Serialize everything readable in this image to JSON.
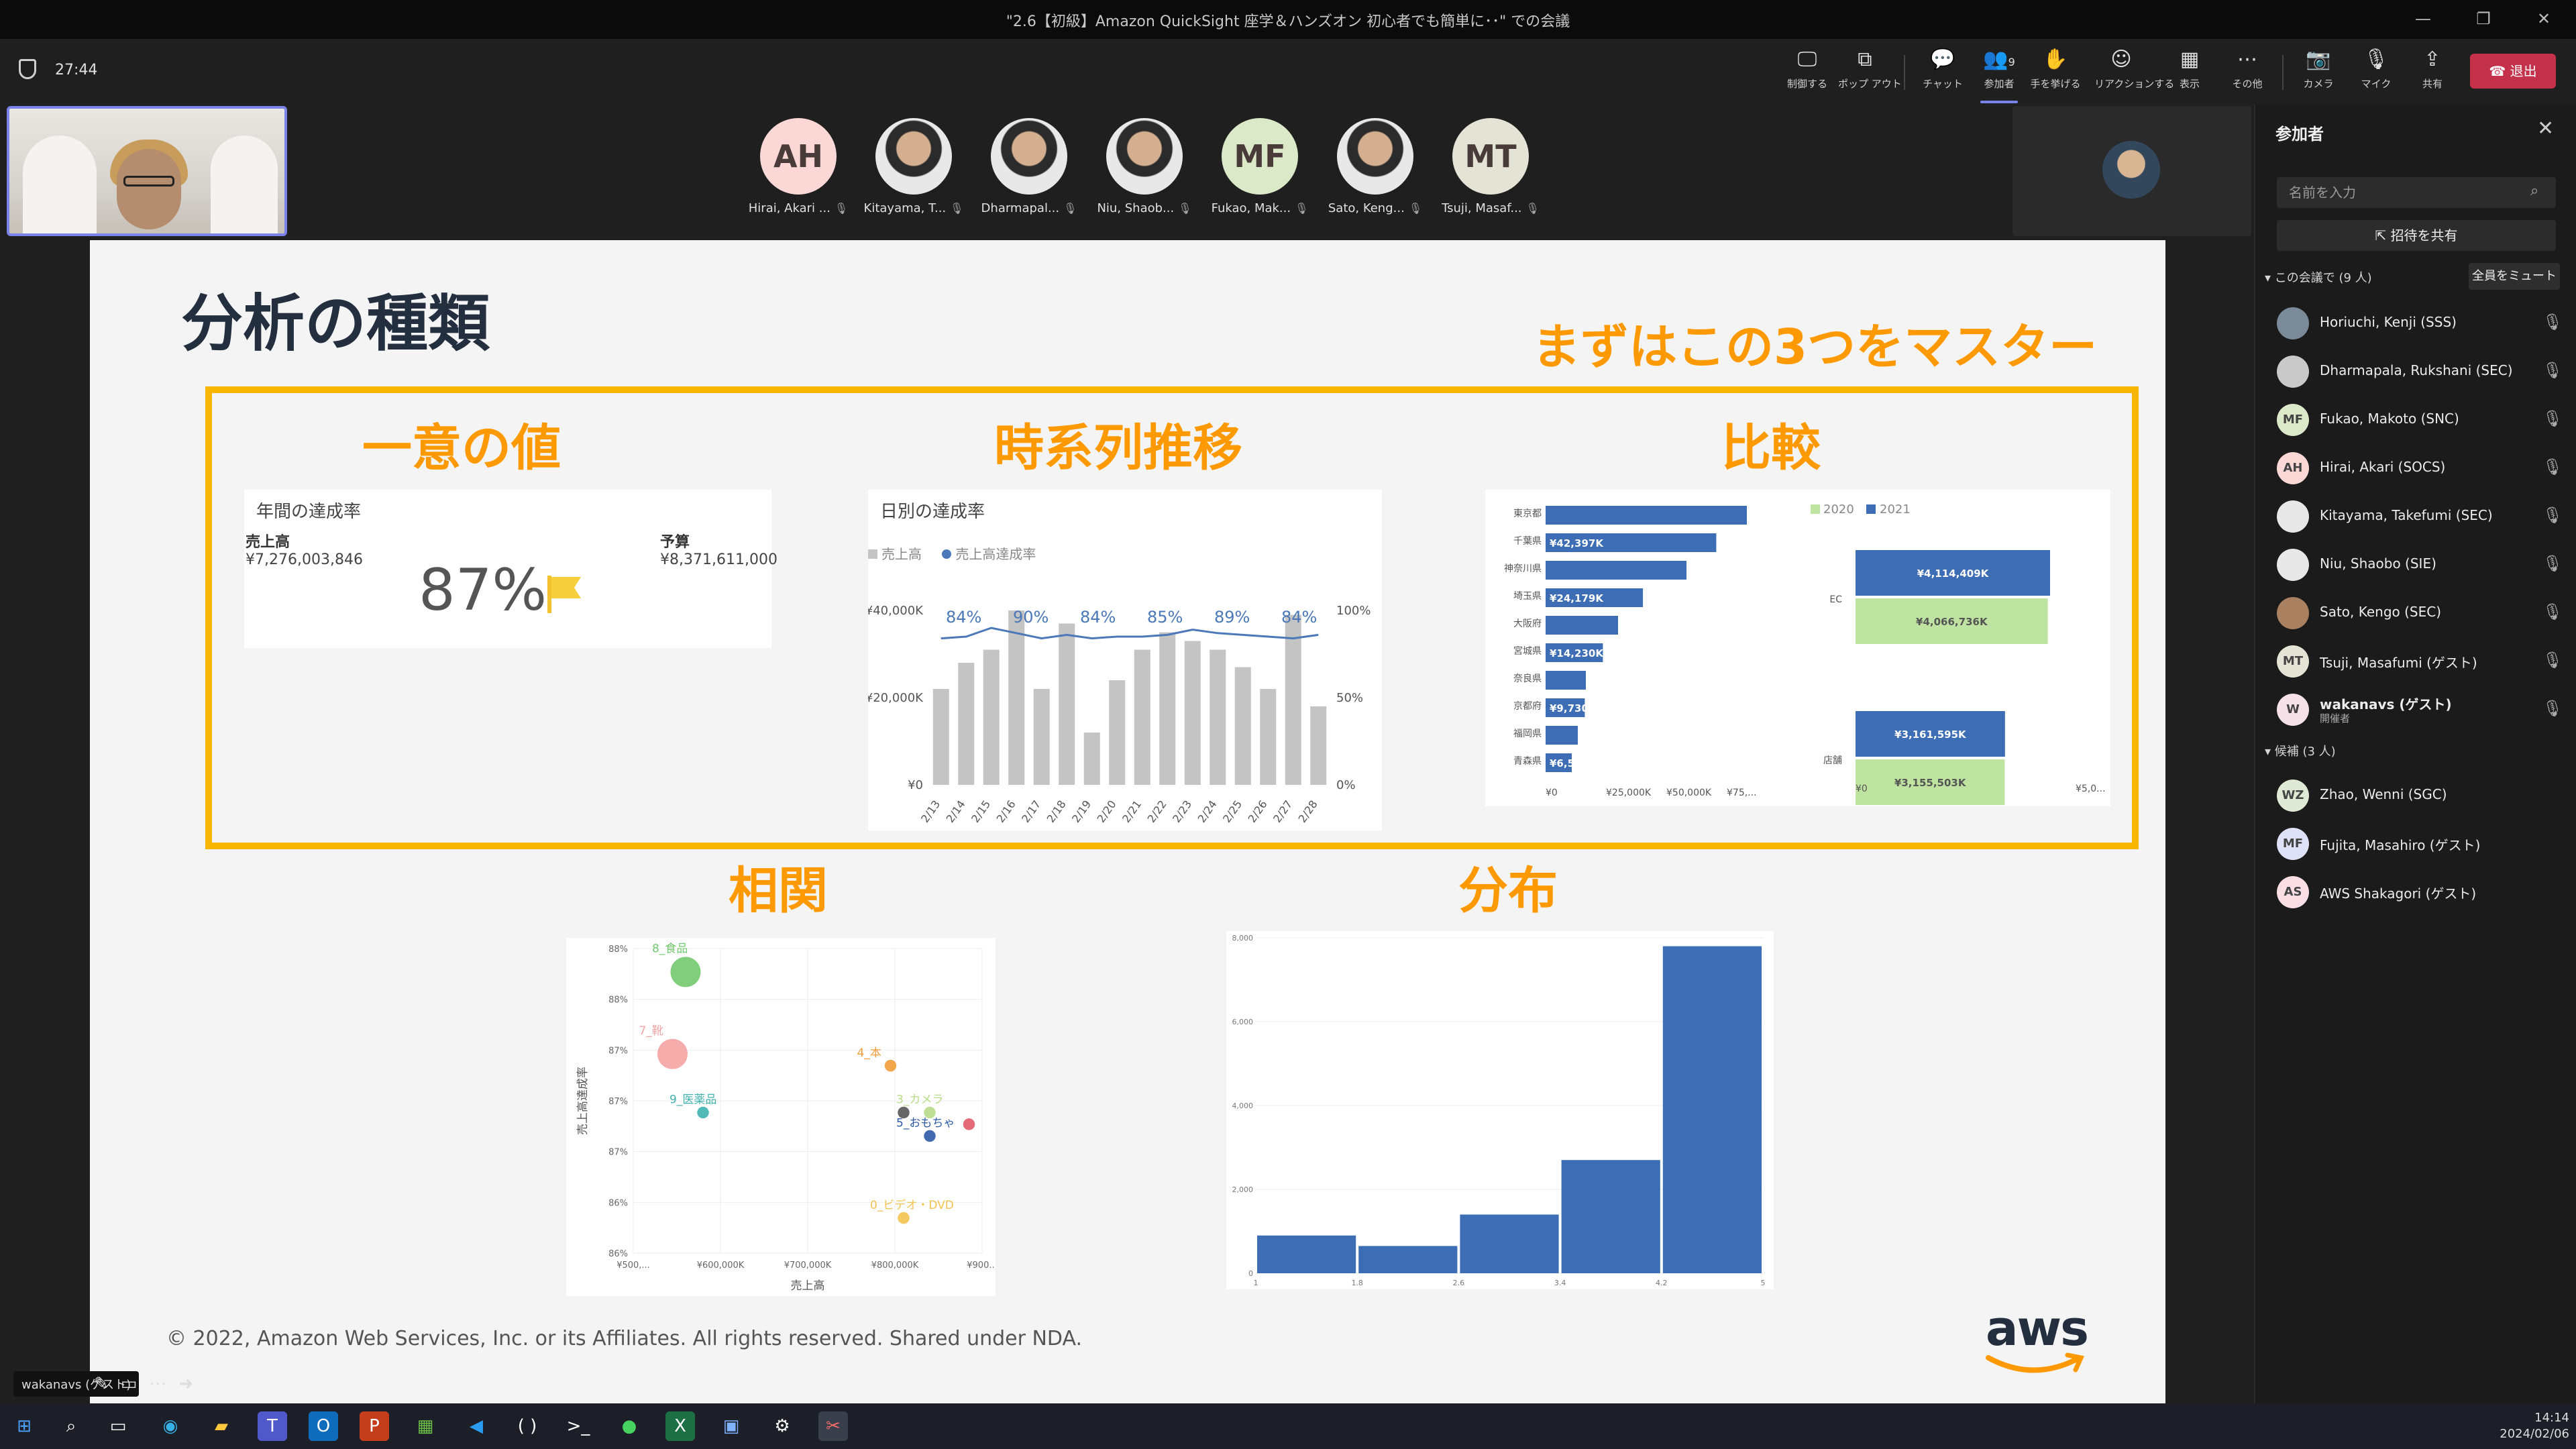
{
  "window": {
    "title": "\"2.6【初級】Amazon QuickSight 座学＆ハンズオン 初心者でも簡単に･･\" での会議",
    "controls": [
      "—",
      "❐",
      "✕"
    ]
  },
  "meeting": {
    "timer": "27:44",
    "toolbar": [
      {
        "name": "control",
        "label": "制御する",
        "icon": "🖵"
      },
      {
        "name": "popout",
        "label": "ポップ アウト",
        "icon": "⧉"
      },
      {
        "name": "chat",
        "label": "チャット",
        "icon": "💬"
      },
      {
        "name": "participants",
        "label": "参加者",
        "icon": "👥",
        "badge": "9"
      },
      {
        "name": "raise-hand",
        "label": "手を挙げる",
        "icon": "✋"
      },
      {
        "name": "react",
        "label": "リアクションする",
        "icon": "☺"
      },
      {
        "name": "view",
        "label": "表示",
        "icon": "▦"
      },
      {
        "name": "more",
        "label": "その他",
        "icon": "⋯"
      },
      {
        "name": "camera",
        "label": "カメラ",
        "icon": "📷"
      },
      {
        "name": "mic",
        "label": "マイク",
        "icon": "🎙"
      },
      {
        "name": "share",
        "label": "共有",
        "icon": "⇪"
      }
    ],
    "leave_label": "退出",
    "stage_participants": [
      {
        "initials": "AH",
        "name": "Hirai, Akari ...",
        "color": "#fbd8d6"
      },
      {
        "initials": "",
        "name": "Kitayama, T...",
        "color": "#d9d9d9"
      },
      {
        "initials": "",
        "name": "Dharmapal...",
        "color": "#d9d9d9"
      },
      {
        "initials": "",
        "name": "Niu, Shaob...",
        "color": "#d9d9d9"
      },
      {
        "initials": "MF",
        "name": "Fukao, Mak...",
        "color": "#dbe9c9"
      },
      {
        "initials": "",
        "name": "Sato, Keng...",
        "color": "#d9d9d9"
      },
      {
        "initials": "MT",
        "name": "Tsuji, Masaf...",
        "color": "#e3e3d6"
      }
    ],
    "self_name_chip": "wakanavs (ゲスト)"
  },
  "slide": {
    "title": "分析の種類",
    "subtitle": "まずはこの3つをマスター",
    "sections": {
      "unique": "一意の値",
      "timeseries": "時系列推移",
      "compare": "比較",
      "correlation": "相関",
      "distribution": "分布"
    },
    "kpi": {
      "title": "年間の達成率",
      "sales_label": "売上高",
      "sales_value": "¥7,276,003,846",
      "budget_label": "予算",
      "budget_value": "¥8,371,611,000",
      "percent": "87%"
    },
    "footer": "© 2022, Amazon Web Services, Inc. or its Affiliates. All rights reserved. Shared under NDA.",
    "logo": "aws"
  },
  "chart_data": [
    {
      "type": "bar",
      "title": "日別の達成率",
      "legend": [
        "売上高",
        "売上高達成率"
      ],
      "categories": [
        "2/13",
        "2/14",
        "2/15",
        "2/16",
        "2/17",
        "2/18",
        "2/19",
        "2/20",
        "2/21",
        "2/22",
        "2/23",
        "2/24",
        "2/25",
        "2/26",
        "2/27",
        "2/28"
      ],
      "series": [
        {
          "name": "売上高",
          "values": [
            22000,
            28000,
            31000,
            40000,
            22000,
            37000,
            12000,
            24000,
            31000,
            35000,
            33000,
            31000,
            27000,
            22000,
            39000,
            18000
          ]
        },
        {
          "name": "売上高達成率",
          "values": [
            84,
            85,
            90,
            87,
            84,
            86,
            84,
            85,
            85,
            86,
            89,
            87,
            86,
            85,
            84,
            86
          ]
        }
      ],
      "point_labels": [
        "84%",
        "90%",
        "84%",
        "85%",
        "89%",
        "84%"
      ],
      "y_ticks": [
        "¥0",
        "¥20,000K",
        "¥40,000K"
      ],
      "y2_ticks": [
        "0%",
        "50%",
        "100%"
      ],
      "ylim": [
        0,
        40000
      ]
    },
    {
      "type": "bar",
      "orientation": "horizontal",
      "categories": [
        "東京都",
        "千葉県",
        "神奈川県",
        "埼玉県",
        "大阪府",
        "宮城県",
        "奈良県",
        "京都府",
        "福岡県",
        "青森県"
      ],
      "values": [
        50000,
        42397,
        35000,
        24179,
        18000,
        14230,
        10000,
        9730,
        8000,
        6505
      ],
      "data_labels": [
        "",
        "¥42,397K",
        "",
        "¥24,179K",
        "",
        "¥14,230K",
        "",
        "¥9,730K",
        "",
        "¥6,505K"
      ],
      "x_ticks": [
        "¥0",
        "¥25,000K",
        "¥50,000K",
        "¥75,..."
      ],
      "color": "#3d6db5"
    },
    {
      "type": "bar",
      "orientation": "horizontal",
      "legend": [
        "2020",
        "2021"
      ],
      "categories": [
        "EC",
        "店舗"
      ],
      "series": [
        {
          "name": "2021",
          "values": [
            4114409,
            3161595
          ],
          "labels": [
            "¥4,114,409K",
            "¥3,161,595K"
          ],
          "color": "#3d6db5"
        },
        {
          "name": "2020",
          "values": [
            4066736,
            3155503
          ],
          "labels": [
            "¥4,066,736K",
            "¥3,155,503K"
          ],
          "color": "#bfe3a0"
        }
      ],
      "x_ticks": [
        "¥0",
        "¥5,0..."
      ]
    },
    {
      "type": "scatter",
      "xlabel": "売上高",
      "ylabel": "売上高達成率",
      "x_ticks": [
        "¥500,...",
        "¥600,000K",
        "¥700,000K",
        "¥800,000K",
        "¥900..."
      ],
      "y_ticks": [
        "86%",
        "86%",
        "87%",
        "87%",
        "87%",
        "88%",
        "88%"
      ],
      "points": [
        {
          "label": "8_食品",
          "x": 560000,
          "y": 88.4,
          "size": 18,
          "color": "#73c96f"
        },
        {
          "label": "7_靴",
          "x": 545000,
          "y": 87.7,
          "size": 18,
          "color": "#f6a3a3"
        },
        {
          "label": "4_本",
          "x": 795000,
          "y": 87.6,
          "size": 7,
          "color": "#f19c38"
        },
        {
          "label": "9_医薬品",
          "x": 580000,
          "y": 87.2,
          "size": 7,
          "color": "#3fb3b0"
        },
        {
          "label": "3_カメラ",
          "x": 840000,
          "y": 87.2,
          "size": 7,
          "color": "#b7dc87"
        },
        {
          "label": "",
          "x": 810000,
          "y": 87.2,
          "size": 7,
          "color": "#555555"
        },
        {
          "label": "5_おもちゃ",
          "x": 840000,
          "y": 87.0,
          "size": 7,
          "color": "#2c5aa8"
        },
        {
          "label": "",
          "x": 885000,
          "y": 87.1,
          "size": 7,
          "color": "#e25b6a"
        },
        {
          "label": "0_ビデオ・DVD",
          "x": 810000,
          "y": 86.3,
          "size": 7,
          "color": "#f2c34f"
        }
      ]
    },
    {
      "type": "bar",
      "subtype": "histogram",
      "bins": [
        "1",
        "1.8",
        "2.6",
        "3.4",
        "4.2",
        "5"
      ],
      "values": [
        900,
        650,
        1400,
        2700,
        7800
      ],
      "y_ticks": [
        "0",
        "2,000",
        "4,000",
        "6,000",
        "8,000"
      ],
      "ylim": [
        0,
        8000
      ],
      "color": "#3d6db5"
    }
  ],
  "panel": {
    "title": "参加者",
    "search_placeholder": "名前を入力",
    "share_invite": "招待を共有",
    "in_meeting_label": "この会議で (9 人)",
    "mute_all": "全員をミュート",
    "in_meeting": [
      {
        "name": "Horiuchi, Kenji (SSS)",
        "initials": "",
        "color": "#7a8a99"
      },
      {
        "name": "Dharmapala, Rukshani (SEC)",
        "initials": "",
        "color": "#c9c9c9"
      },
      {
        "name": "Fukao, Makoto (SNC)",
        "initials": "MF",
        "color": "#dbe9c9"
      },
      {
        "name": "Hirai, Akari (SOCS)",
        "initials": "AH",
        "color": "#fbd8d6"
      },
      {
        "name": "Kitayama, Takefumi (SEC)",
        "initials": "",
        "color": "#e8e8e8"
      },
      {
        "name": "Niu, Shaobo (SIE)",
        "initials": "",
        "color": "#e8e8e8"
      },
      {
        "name": "Sato, Kengo (SEC)",
        "initials": "",
        "color": "#a98060"
      },
      {
        "name": "Tsuji, Masafumi (ゲスト)",
        "initials": "MT",
        "color": "#e3e3d6"
      },
      {
        "name": "wakanavs (ゲスト)",
        "initials": "W",
        "color": "#f7e1e8",
        "role": "開催者"
      }
    ],
    "suggested_label": "候補 (3 人)",
    "suggested": [
      {
        "name": "Zhao, Wenni (SGC)",
        "initials": "WZ",
        "color": "#dfe9d6"
      },
      {
        "name": "Fujita, Masahiro (ゲスト)",
        "initials": "MF",
        "color": "#dfe2f6"
      },
      {
        "name": "AWS Shakagori (ゲスト)",
        "initials": "AS",
        "color": "#fbdde4"
      }
    ]
  },
  "taskbar": {
    "time": "14:14",
    "date": "2024/02/06"
  }
}
